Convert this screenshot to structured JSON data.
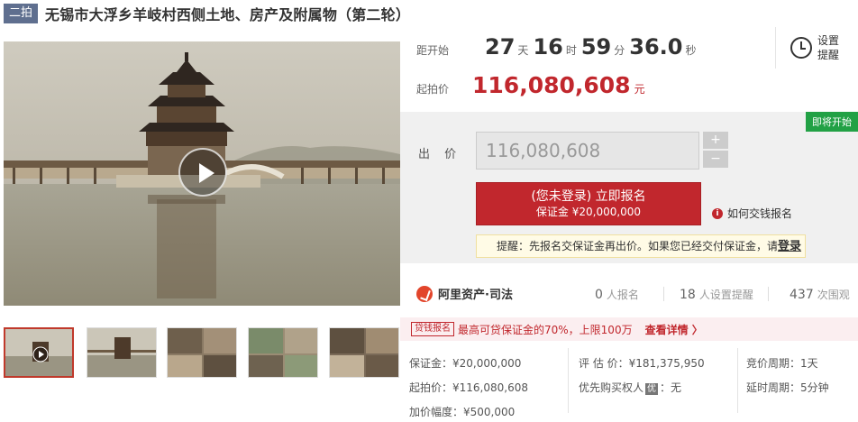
{
  "title": {
    "round_tag": "二拍",
    "text": "无锡市大浮乡羊岐村西侧土地、房产及附属物（第二轮）"
  },
  "countdown": {
    "label": "距开始",
    "days": "27",
    "days_unit": "天",
    "hours": "16",
    "hours_unit": "时",
    "minutes": "59",
    "minutes_unit": "分",
    "seconds": "36.0",
    "seconds_unit": "秒"
  },
  "reminder": {
    "label": "设置提醒"
  },
  "start_price": {
    "label": "起拍价",
    "value": "116,080,608",
    "unit": "元"
  },
  "bid": {
    "status_badge": "即将开始",
    "label": "出 价",
    "value": "116,080,608",
    "plus": "+",
    "minus": "−",
    "signup_line1": "(您未登录) 立即报名",
    "signup_line2": "保证金 ¥20,000,000",
    "howto": "如何交钱报名",
    "notice_text": "提醒：先报名交保证金再出价。如果您已经交付保证金，请",
    "notice_login": "登录"
  },
  "stats": {
    "brand": "阿里资产·司法",
    "signups": "0",
    "signups_label": "人报名",
    "reminders": "18",
    "reminders_label": "人设置提醒",
    "views": "437",
    "views_label": "次围观"
  },
  "loan": {
    "tag": "贷钱报名",
    "text": "最高可贷保证金的70%，上限100万",
    "link": "查看详情 〉"
  },
  "details": {
    "deposit": "保证金：¥20,000,000",
    "appraisal": "评 估 价：¥181,375,950",
    "cycle": "竞价周期：1天",
    "start": "起拍价：¥116,080,608",
    "priority_label": "优先购买权人",
    "priority_tag": "优",
    "priority_value": "：无",
    "delay": "延时周期：5分钟",
    "increment": "加价幅度：¥500,000"
  }
}
